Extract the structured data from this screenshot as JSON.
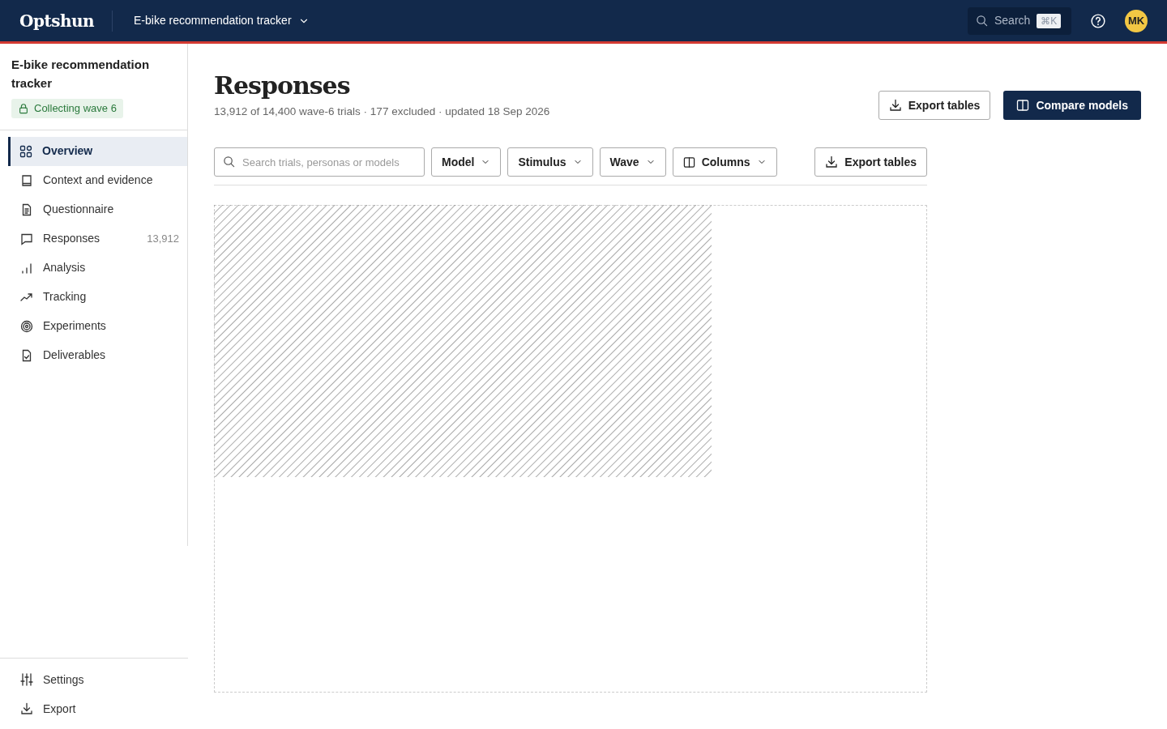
{
  "topbar": {
    "logo": "Optshun",
    "project": "E-bike recommendation tracker",
    "search": {
      "placeholder": "Search",
      "shortcut": "⌘K"
    },
    "avatar": "MK"
  },
  "sidebar": {
    "title": "E-bike recommendation tracker",
    "status": "Collecting wave 6",
    "items": [
      {
        "label": "Overview",
        "selected": true
      },
      {
        "label": "Context and evidence",
        "selected": false
      },
      {
        "label": "Questionnaire",
        "selected": false
      },
      {
        "label": "Responses",
        "selected": false,
        "count": "13,912"
      },
      {
        "label": "Analysis",
        "selected": false
      },
      {
        "label": "Tracking",
        "selected": false
      },
      {
        "label": "Experiments",
        "selected": false
      },
      {
        "label": "Deliverables",
        "selected": false
      }
    ],
    "footer": [
      {
        "label": "Settings"
      },
      {
        "label": "Export"
      }
    ]
  },
  "header": {
    "title": "Responses",
    "subtitle": "13,912 of 14,400 wave-6 trials · 177 excluded · updated 18 Sep 2026",
    "actions": [
      {
        "label": "Export tables",
        "kind": "outline"
      },
      {
        "label": "Compare models",
        "kind": "primary"
      }
    ]
  },
  "toolbar": {
    "search": {
      "placeholder": "Search trials, personas or models"
    },
    "filters": [
      {
        "label": "Model",
        "kind": "menu"
      },
      {
        "label": "Stimulus",
        "kind": "menu"
      },
      {
        "label": "Wave",
        "kind": "menu"
      },
      {
        "label": "Columns",
        "kind": "columns"
      }
    ],
    "export": "Export tables"
  }
}
